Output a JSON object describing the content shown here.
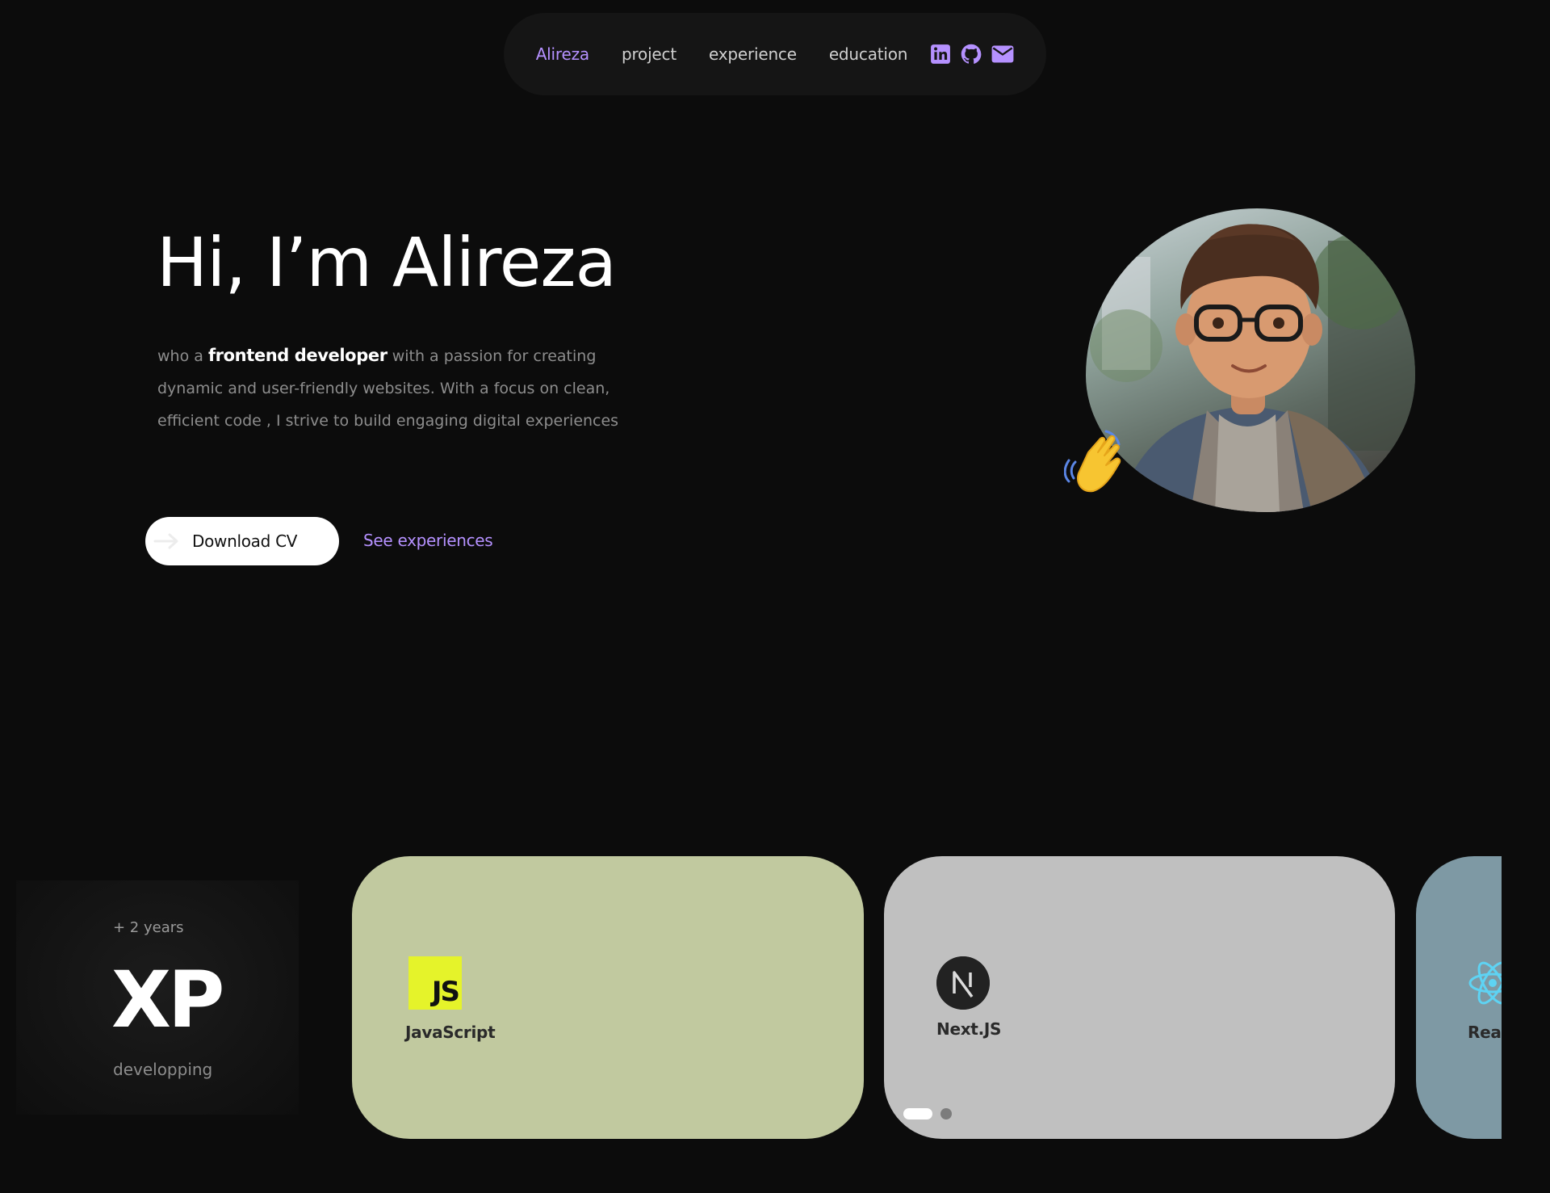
{
  "nav": {
    "items": [
      {
        "label": "Alireza",
        "active": true
      },
      {
        "label": "project",
        "active": false
      },
      {
        "label": "experience",
        "active": false
      },
      {
        "label": "education",
        "active": false
      }
    ],
    "socials": [
      "linkedin-icon",
      "github-icon",
      "mail-icon"
    ],
    "accent": "#b591ff"
  },
  "hero": {
    "title": "Hi, I’m Alireza",
    "intro_prefix": "who a ",
    "intro_strong": "frontend developer",
    "intro_rest": " with a passion for creating dynamic and user-friendly websites. With a focus on clean, efficient code , I strive to build engaging digital experiences",
    "download_label": "Download CV",
    "experiences_label": "See experiences"
  },
  "xp": {
    "years": "+ 2 years",
    "big": "XP",
    "sub": "developping"
  },
  "skills": [
    {
      "label": "JavaScript",
      "logo_text": "JS",
      "color": "#c1c99f"
    },
    {
      "label": "Next.JS",
      "logo_text": "N",
      "color": "#c0c0c0"
    },
    {
      "label": "Reac",
      "color": "#7e99a4"
    }
  ]
}
